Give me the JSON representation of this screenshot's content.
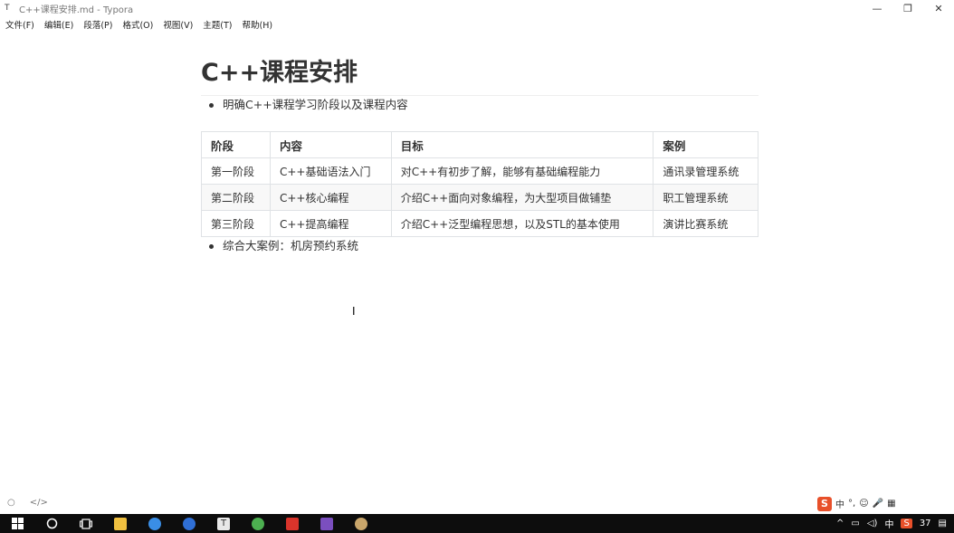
{
  "window": {
    "icon": "typora-app-icon",
    "title": "C++课程安排.md - Typora",
    "minimize": "—",
    "restore": "❐",
    "close": "✕"
  },
  "menu": [
    "文件(F)",
    "编辑(E)",
    "段落(P)",
    "格式(O)",
    "视图(V)",
    "主题(T)",
    "帮助(H)"
  ],
  "document": {
    "heading": "C++课程安排",
    "bullet1": "明确C++课程学习阶段以及课程内容",
    "table": {
      "headers": [
        "阶段",
        "内容",
        "目标",
        "案例"
      ],
      "rows": [
        [
          "第一阶段",
          "C++基础语法入门",
          "对C++有初步了解，能够有基础编程能力",
          "通讯录管理系统"
        ],
        [
          "第二阶段",
          "C++核心编程",
          "介绍C++面向对象编程，为大型项目做铺垫",
          "职工管理系统"
        ],
        [
          "第三阶段",
          "C++提高编程",
          "介绍C++泛型编程思想，以及STL的基本使用",
          "演讲比赛系统"
        ]
      ]
    },
    "bullet2": "综合大案例：机房预约系统"
  },
  "statusbar": {
    "sidebar_toggle": "○",
    "source_mode": "</>"
  },
  "taskbar": {
    "icons": [
      "windows-start-icon",
      "search-circle-icon",
      "task-view-icon",
      "file-explorer-icon",
      "browser-icon",
      "baidu-netdisk-icon",
      "typora-icon",
      "green-app-icon",
      "xmind-icon",
      "visual-studio-icon",
      "paint-icon"
    ],
    "tray": {
      "ime": "中",
      "clock": "37"
    }
  },
  "ime_toolbar": {
    "logo": "S",
    "mode": "中"
  },
  "colors": {
    "text": "#333333",
    "table_border": "#dfe2e5",
    "alt_row": "#f8f8f8",
    "taskbar": "#0d0d0d",
    "ime_accent": "#e8502a"
  }
}
